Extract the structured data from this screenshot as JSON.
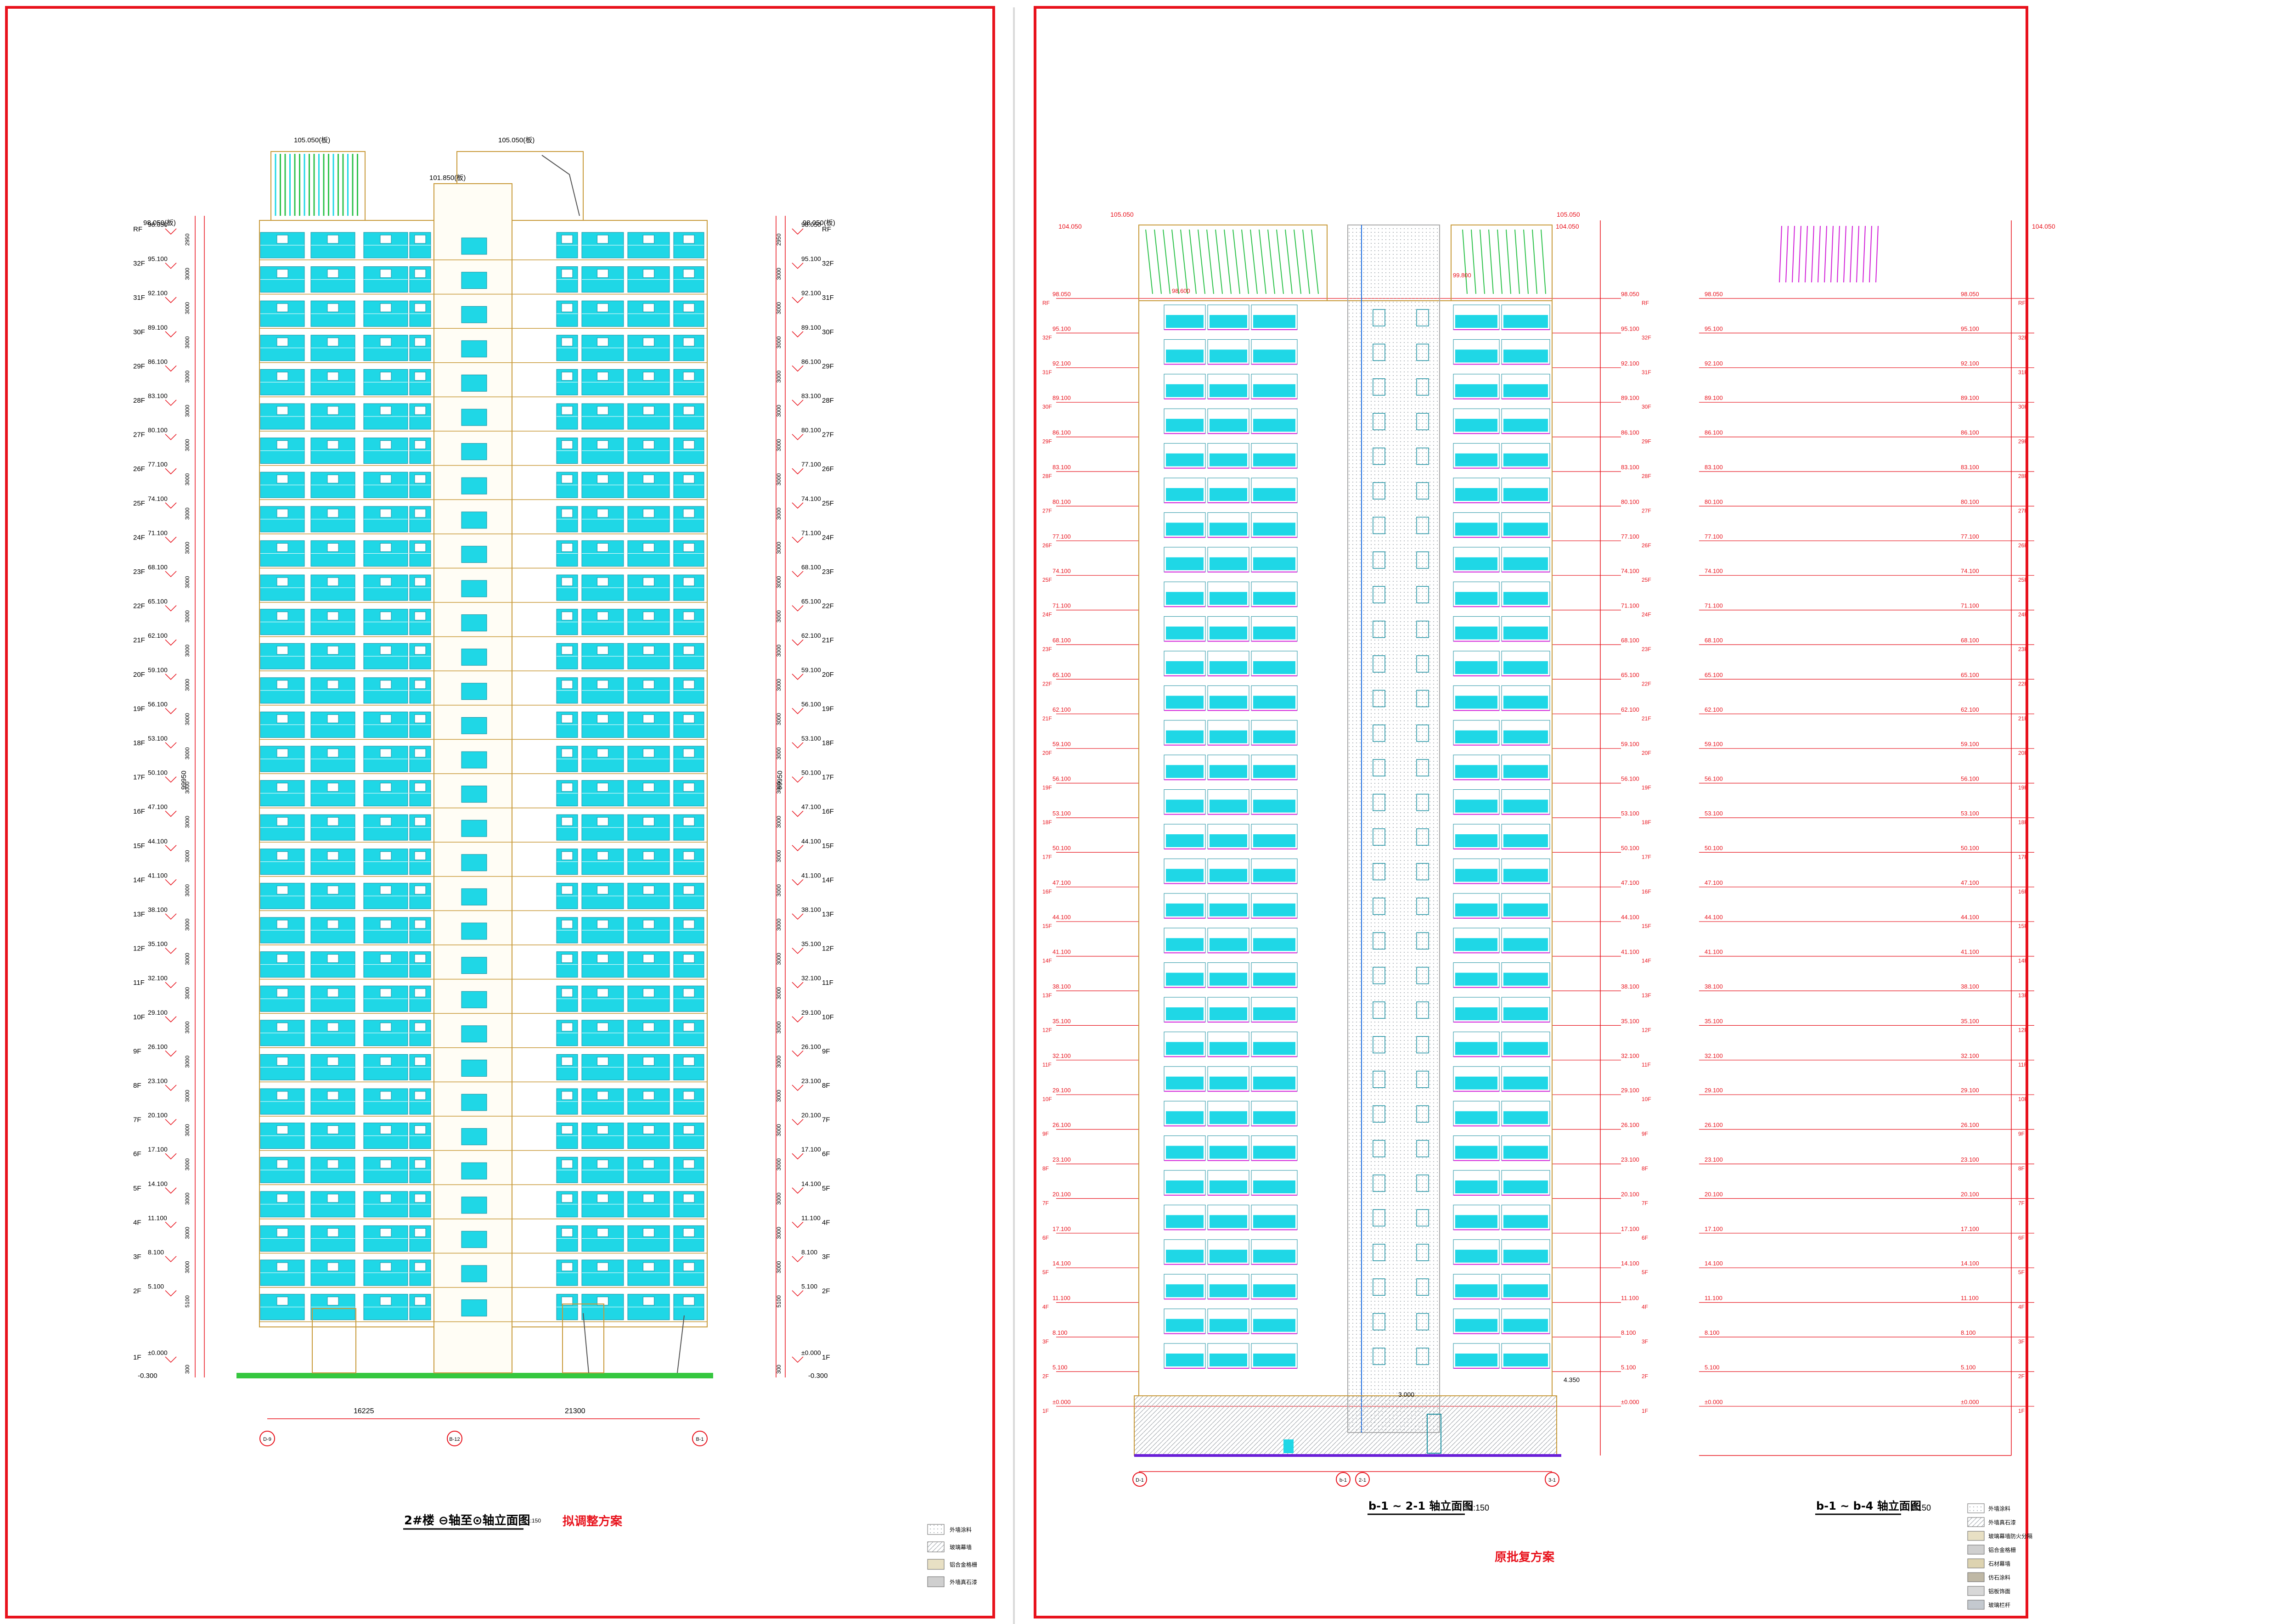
{
  "left_sheet": {
    "title": "2#楼  ⊖轴至⊙轴立面图",
    "scale": "1:150",
    "subtitle": "拟调整方案",
    "top_level_a": "105.050(板)",
    "top_level_b": "105.050(板)",
    "top_level_c": "101.850(板)",
    "roof_level_left": "98.050(板)",
    "roof_level_right": "98.050(板)",
    "ground_level": "±0.000",
    "bottom_level": "-0.300",
    "total_height": "99950",
    "dim_left": "16225",
    "dim_right": "21300",
    "axis_left": "D-9",
    "axis_mid": "B-12",
    "axis_right": "B-1"
  },
  "right_sheet": {
    "title_a": "b-1 ~ 2-1 轴立面图",
    "scale_a": "1:150",
    "title_b": "b-1 ~ b-4 轴立面图",
    "scale_b": "1:150",
    "subtitle": "原批复方案",
    "top_level_a": "104.050",
    "top_level_b": "105.050",
    "top_level_c": "104.050",
    "top_level_d": "105.050",
    "top_level_e": "104.050",
    "top_level_f": "98.600",
    "top_level_g": "99.800",
    "ground_level": "±0.000",
    "podium_level": "3.000",
    "podium_level_r": "4.350",
    "axis_1": "D-1",
    "axis_2": "b-1",
    "axis_3": "2-1",
    "axis_4": "3-1"
  },
  "floors": [
    {
      "name": "RF",
      "level": "98.050"
    },
    {
      "name": "32F",
      "level": "95.100"
    },
    {
      "name": "31F",
      "level": "92.100"
    },
    {
      "name": "30F",
      "level": "89.100"
    },
    {
      "name": "29F",
      "level": "86.100"
    },
    {
      "name": "28F",
      "level": "83.100"
    },
    {
      "name": "27F",
      "level": "80.100"
    },
    {
      "name": "26F",
      "level": "77.100"
    },
    {
      "name": "25F",
      "level": "74.100"
    },
    {
      "name": "24F",
      "level": "71.100"
    },
    {
      "name": "23F",
      "level": "68.100"
    },
    {
      "name": "22F",
      "level": "65.100"
    },
    {
      "name": "21F",
      "level": "62.100"
    },
    {
      "name": "20F",
      "level": "59.100"
    },
    {
      "name": "19F",
      "level": "56.100"
    },
    {
      "name": "18F",
      "level": "53.100"
    },
    {
      "name": "17F",
      "level": "50.100"
    },
    {
      "name": "16F",
      "level": "47.100"
    },
    {
      "name": "15F",
      "level": "44.100"
    },
    {
      "name": "14F",
      "level": "41.100"
    },
    {
      "name": "13F",
      "level": "38.100"
    },
    {
      "name": "12F",
      "level": "35.100"
    },
    {
      "name": "11F",
      "level": "32.100"
    },
    {
      "name": "10F",
      "level": "29.100"
    },
    {
      "name": "9F",
      "level": "26.100"
    },
    {
      "name": "8F",
      "level": "23.100"
    },
    {
      "name": "7F",
      "level": "20.100"
    },
    {
      "name": "6F",
      "level": "17.100"
    },
    {
      "name": "5F",
      "level": "14.100"
    },
    {
      "name": "4F",
      "level": "11.100"
    },
    {
      "name": "3F",
      "level": "8.100"
    },
    {
      "name": "2F",
      "level": "5.100"
    },
    {
      "name": "1F",
      "level": "±0.000"
    }
  ],
  "storey_dims": [
    "2950",
    "3000",
    "3000",
    "3000",
    "3000",
    "3000",
    "3000",
    "3000",
    "3000",
    "3000",
    "3000",
    "3000",
    "3000",
    "3000",
    "3000",
    "3000",
    "3000",
    "3000",
    "3000",
    "3000",
    "3000",
    "3000",
    "3000",
    "3000",
    "3000",
    "3000",
    "3000",
    "3000",
    "3000",
    "3000",
    "3000",
    "5100",
    "300"
  ],
  "colors": {
    "frame": "#e8121c",
    "glass": "#1fd7e6",
    "frame_line": "#c89a3a",
    "green_trellis": "#2ec24b",
    "magenta": "#d21fd8",
    "ground": "#35c73f",
    "grid_red": "#e8121c"
  },
  "legend_left": [
    "外墙涂料",
    "玻璃幕墙",
    "铝合金格栅",
    "外墙真石漆"
  ],
  "legend_right": [
    "外墙涂料",
    "外墙真石漆",
    "玻璃幕墙防火分隔",
    "铝合金格栅",
    "石材幕墙",
    "仿石涂料",
    "铝板饰面",
    "玻璃栏杆"
  ]
}
